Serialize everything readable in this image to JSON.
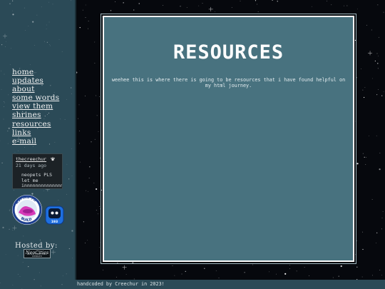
{
  "nav": {
    "items": [
      "home",
      "updates",
      "about",
      "some words",
      "view them",
      "shrines",
      "resources",
      "links",
      "e-mail"
    ]
  },
  "status": {
    "username": "thecreechur",
    "time": "21 days ago",
    "message_line1": "neopets PLS",
    "message_line2": "let me",
    "message_line3": "innnnnnnnnnnnnn",
    "icon": "paw-icon"
  },
  "badges": {
    "round_text_top": "ASPIRE TO",
    "round_text_bottom": "BUILD",
    "app_label": "193"
  },
  "hosting": {
    "label": "Hosted by:",
    "logo_text": "NeoCities",
    "logo_subtext": "BUILD YOUR OWN WEBSITE"
  },
  "main": {
    "title": "RESOURCES",
    "intro": "weehee this is where there is going to be resources that i have found helpful on my html journey."
  },
  "footer": {
    "text": "handcoded by Creechur in 2023!"
  },
  "colors": {
    "sidebar": "#2b4a57",
    "panel": "#48727f",
    "space": "#06080d",
    "text": "#ffffff"
  }
}
